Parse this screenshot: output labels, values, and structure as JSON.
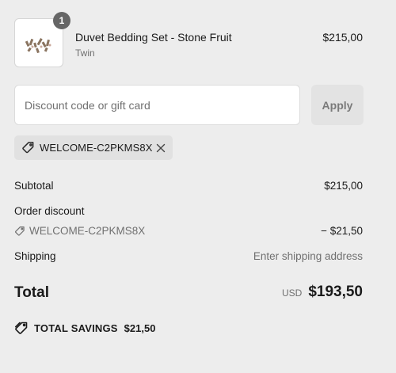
{
  "line_item": {
    "quantity": "1",
    "name": "Duvet Bedding Set - Stone Fruit",
    "variant": "Twin",
    "price": "$215,00",
    "thumbnail_icon": "product-image"
  },
  "discount": {
    "placeholder": "Discount code or gift card",
    "value": "",
    "apply_label": "Apply",
    "applied_code": "WELCOME-C2PKMS8X"
  },
  "summary": {
    "subtotal_label": "Subtotal",
    "subtotal_value": "$215,00",
    "order_discount_label": "Order discount",
    "discount_code": "WELCOME-C2PKMS8X",
    "discount_value": "− $21,50",
    "shipping_label": "Shipping",
    "shipping_value": "Enter shipping address",
    "total_label": "Total",
    "currency": "USD",
    "total_value": "$193,50",
    "savings_label": "TOTAL SAVINGS",
    "savings_value": "$21,50"
  },
  "colors": {
    "background": "#ededed",
    "muted_text": "#707070",
    "badge": "#666666"
  }
}
